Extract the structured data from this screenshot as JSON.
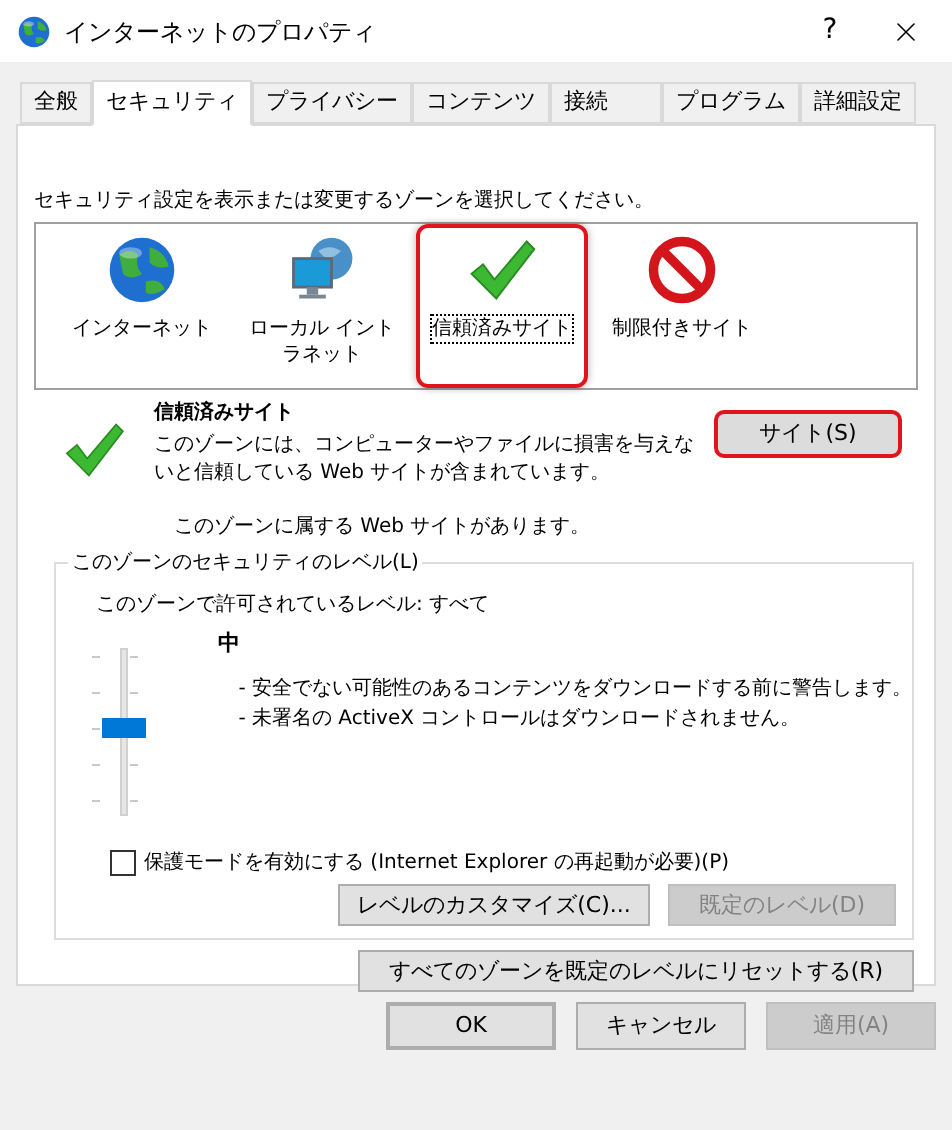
{
  "window": {
    "title": "インターネットのプロパティ",
    "help": "?"
  },
  "tabs": [
    {
      "label": "全般",
      "selected": false
    },
    {
      "label": "セキュリティ",
      "selected": true
    },
    {
      "label": "プライバシー",
      "selected": false
    },
    {
      "label": "コンテンツ",
      "selected": false
    },
    {
      "label": "接続",
      "selected": false
    },
    {
      "label": "プログラム",
      "selected": false
    },
    {
      "label": "詳細設定",
      "selected": false
    }
  ],
  "zone_prompt": "セキュリティ設定を表示または変更するゾーンを選択してください。",
  "zones": [
    {
      "label": "インターネット",
      "kind": "internet",
      "selected": false,
      "highlighted": false
    },
    {
      "label": "ローカル イントラネット",
      "kind": "intranet",
      "selected": false,
      "highlighted": false
    },
    {
      "label": "信頼済みサイト",
      "kind": "trusted",
      "selected": true,
      "highlighted": true
    },
    {
      "label": "制限付きサイト",
      "kind": "restricted",
      "selected": false,
      "highlighted": false
    }
  ],
  "zone_info": {
    "title": "信頼済みサイト",
    "kind": "trusted",
    "description": "このゾーンには、コンピューターやファイルに損害を与えないと信頼している Web サイトが含まれています。",
    "sites_note": "このゾーンに属する Web サイトがあります。",
    "sites_button": {
      "label": "サイト(S)",
      "highlighted": true
    }
  },
  "security_level": {
    "legend": "このゾーンのセキュリティのレベル(L)",
    "allowed": "このゾーンで許可されているレベル: すべて",
    "slider": {
      "level": 0.5
    },
    "level_name": "中",
    "details": [
      "- 安全でない可能性のあるコンテンツをダウンロードする前に警告します。",
      "- 未署名の ActiveX コントロールはダウンロードされません。"
    ],
    "protected_mode": {
      "label": "保護モードを有効にする (Internet Explorer の再起動が必要)(P)",
      "checked": false
    },
    "buttons": [
      {
        "label": "レベルのカスタマイズ(C)...",
        "disabled": false
      },
      {
        "label": "既定のレベル(D)",
        "disabled": true
      }
    ]
  },
  "reset_button": "すべてのゾーンを既定のレベルにリセットする(R)",
  "dialog_buttons": [
    {
      "label": "OK",
      "default": true,
      "disabled": false
    },
    {
      "label": "キャンセル",
      "default": false,
      "disabled": false
    },
    {
      "label": "適用(A)",
      "default": false,
      "disabled": true
    }
  ]
}
